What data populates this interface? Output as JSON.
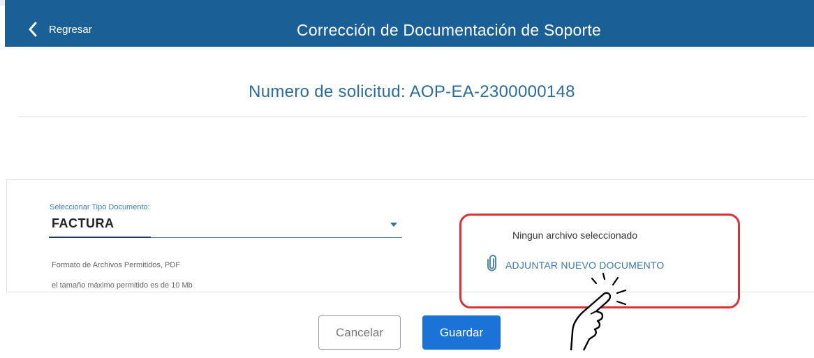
{
  "header": {
    "back_label": "Regresar",
    "title": "Corrección de Documentación de Soporte"
  },
  "request": {
    "label": "Numero de solicitud: AOP-EA-2300000148"
  },
  "document_form": {
    "select_label": "Seleccionar Tipo Documento:",
    "selected_value": "FACTURA",
    "formats_note": "Formato de Archivos Permitidos, PDF",
    "size_note": "el tamaño máximo permitido es de 10 Mb"
  },
  "attachment": {
    "status": "Ningun archivo seleccionado",
    "attach_label": "ADJUNTAR NUEVO DOCUMENTO"
  },
  "actions": {
    "cancel_label": "Cancelar",
    "save_label": "Guardar"
  },
  "colors": {
    "header_bg": "#1a5f95",
    "accent": "#3a78b0",
    "primary_button": "#1b73d8",
    "highlight_border": "#d8333a"
  },
  "icons": [
    "chevron-left-icon",
    "dropdown-caret-icon",
    "paperclip-icon",
    "pointing-hand-icon"
  ]
}
